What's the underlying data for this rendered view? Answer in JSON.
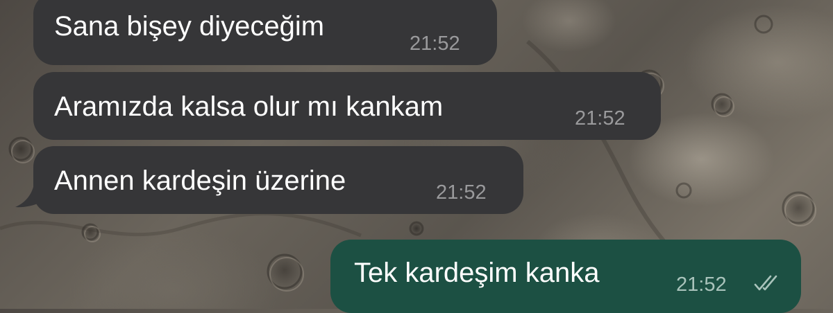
{
  "chat": {
    "messages": [
      {
        "direction": "incoming",
        "text": "Sana bişey diyeceğim",
        "time": "21:52"
      },
      {
        "direction": "incoming",
        "text": "Aramızda kalsa olur mı kankam",
        "time": "21:52"
      },
      {
        "direction": "incoming",
        "text": "Annen kardeşin üzerine",
        "time": "21:52"
      },
      {
        "direction": "outgoing",
        "text": "Tek kardeşim kanka",
        "time": "21:52",
        "status_icon": "double-check-icon"
      }
    ]
  },
  "colors": {
    "incoming_bubble": "#363638",
    "outgoing_bubble": "#1c5043",
    "timestamp": "#9a9a9c"
  }
}
